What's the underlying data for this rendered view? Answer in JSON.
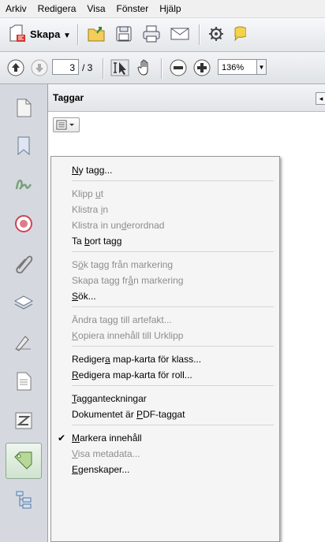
{
  "menubar": [
    "Arkiv",
    "Redigera",
    "Visa",
    "Fönster",
    "Hjälp"
  ],
  "toolbar": {
    "create_label": "Skapa",
    "page_current": "3",
    "page_total": "/ 3",
    "zoom": "136%"
  },
  "panel": {
    "title": "Taggar"
  },
  "menu": {
    "items": [
      {
        "pre": "",
        "u": "N",
        "post": "y tagg...",
        "disabled": false,
        "checked": false
      },
      {
        "pre": "Klipp ",
        "u": "u",
        "post": "t",
        "disabled": true,
        "checked": false
      },
      {
        "pre": "Klistra ",
        "u": "i",
        "post": "n",
        "disabled": true,
        "checked": false
      },
      {
        "pre": "Klistra in un",
        "u": "d",
        "post": "erordnad",
        "disabled": true,
        "checked": false
      },
      {
        "pre": "Ta ",
        "u": "b",
        "post": "ort tagg",
        "disabled": false,
        "checked": false
      },
      {
        "pre": "S",
        "u": "ö",
        "post": "k tagg från markering",
        "disabled": true,
        "checked": false
      },
      {
        "pre": "Skapa tagg fr",
        "u": "å",
        "post": "n markering",
        "disabled": true,
        "checked": false
      },
      {
        "pre": "",
        "u": "S",
        "post": "ök...",
        "disabled": false,
        "checked": false
      },
      {
        "pre": "Ändra tagg till artefakt...",
        "u": "",
        "post": "",
        "disabled": true,
        "checked": false
      },
      {
        "pre": "",
        "u": "K",
        "post": "opiera innehåll till Urklipp",
        "disabled": true,
        "checked": false
      },
      {
        "pre": "Rediger",
        "u": "a",
        "post": " map-karta för klass...",
        "disabled": false,
        "checked": false
      },
      {
        "pre": "",
        "u": "R",
        "post": "edigera map-karta för roll...",
        "disabled": false,
        "checked": false
      },
      {
        "pre": "",
        "u": "T",
        "post": "agganteckningar",
        "disabled": false,
        "checked": false
      },
      {
        "pre": "Dokumentet är ",
        "u": "P",
        "post": "DF-taggat",
        "disabled": false,
        "checked": false
      },
      {
        "pre": "",
        "u": "M",
        "post": "arkera innehåll",
        "disabled": false,
        "checked": true
      },
      {
        "pre": "",
        "u": "V",
        "post": "isa metadata...",
        "disabled": true,
        "checked": false
      },
      {
        "pre": "",
        "u": "E",
        "post": "genskaper...",
        "disabled": false,
        "checked": false
      }
    ]
  }
}
